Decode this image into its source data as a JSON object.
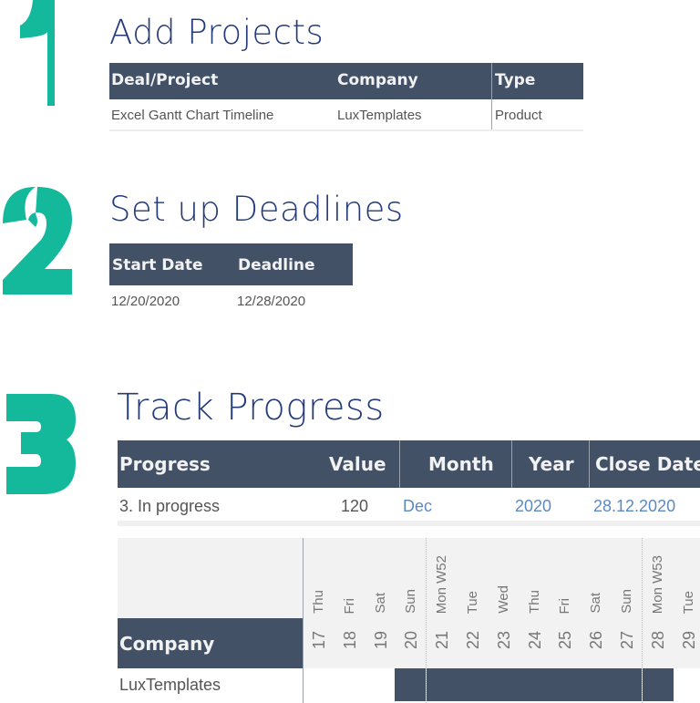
{
  "step1": {
    "number": "1",
    "title": "Add Projects",
    "headers": [
      "Deal/Project",
      "Company",
      "Type"
    ],
    "row": [
      "Excel Gantt Chart Timeline",
      "LuxTemplates",
      "Product"
    ]
  },
  "step2": {
    "number": "2",
    "title": "Set up Deadlines",
    "headers": [
      "Start Date",
      "Deadline"
    ],
    "row": [
      "12/20/2020",
      "12/28/2020"
    ]
  },
  "step3": {
    "number": "3",
    "title": "Track Progress",
    "headers": [
      "Progress",
      "Value",
      "Month",
      "Year",
      "Close Date"
    ],
    "row": [
      "3. In progress",
      "120",
      "Dec",
      "2020",
      "28.12.2020"
    ]
  },
  "gantt": {
    "company_header": "Company",
    "company": "LuxTemplates",
    "days": [
      {
        "num": "17",
        "name": "Thu"
      },
      {
        "num": "18",
        "name": "Fri"
      },
      {
        "num": "19",
        "name": "Sat"
      },
      {
        "num": "20",
        "name": "Sun"
      },
      {
        "num": "21",
        "name": "Mon W52"
      },
      {
        "num": "22",
        "name": "Tue"
      },
      {
        "num": "23",
        "name": "Wed"
      },
      {
        "num": "24",
        "name": "Thu"
      },
      {
        "num": "25",
        "name": "Fri"
      },
      {
        "num": "26",
        "name": "Sat"
      },
      {
        "num": "27",
        "name": "Sun"
      },
      {
        "num": "28",
        "name": "Mon W53"
      },
      {
        "num": "29",
        "name": "Tue"
      }
    ],
    "bar_start_day": "20",
    "bar_end_day": "28"
  },
  "colors": {
    "accent": "#14b89a",
    "header": "#435166",
    "title": "#243b7a",
    "link": "#5b8ac0"
  }
}
